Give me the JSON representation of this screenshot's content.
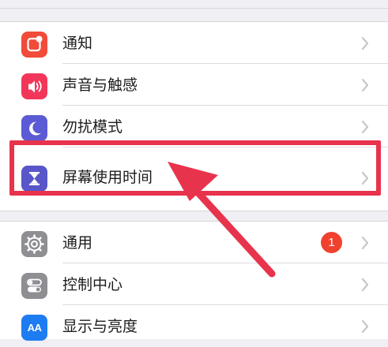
{
  "settings": {
    "group1": [
      {
        "label": "通知",
        "icon": "notifications-icon",
        "color": "#f14b3a"
      },
      {
        "label": "声音与触感",
        "icon": "speaker-icon",
        "color": "#f2365a"
      },
      {
        "label": "勿扰模式",
        "icon": "moon-icon",
        "color": "#5b5bd6"
      },
      {
        "label": "屏幕使用时间",
        "icon": "hourglass-icon",
        "color": "#5856c8"
      }
    ],
    "group2": [
      {
        "label": "通用",
        "icon": "gear-icon",
        "color": "#8e8e93",
        "badge": "1"
      },
      {
        "label": "控制中心",
        "icon": "toggles-icon",
        "color": "#8e8e93"
      },
      {
        "label": "显示与亮度",
        "icon": "text-size-icon",
        "color": "#1e7cf2",
        "icon_text": "AA"
      }
    ]
  },
  "colors": {
    "badge": "#f0412f",
    "highlight": "#e8334d",
    "chevron": "#c7c7cc"
  }
}
